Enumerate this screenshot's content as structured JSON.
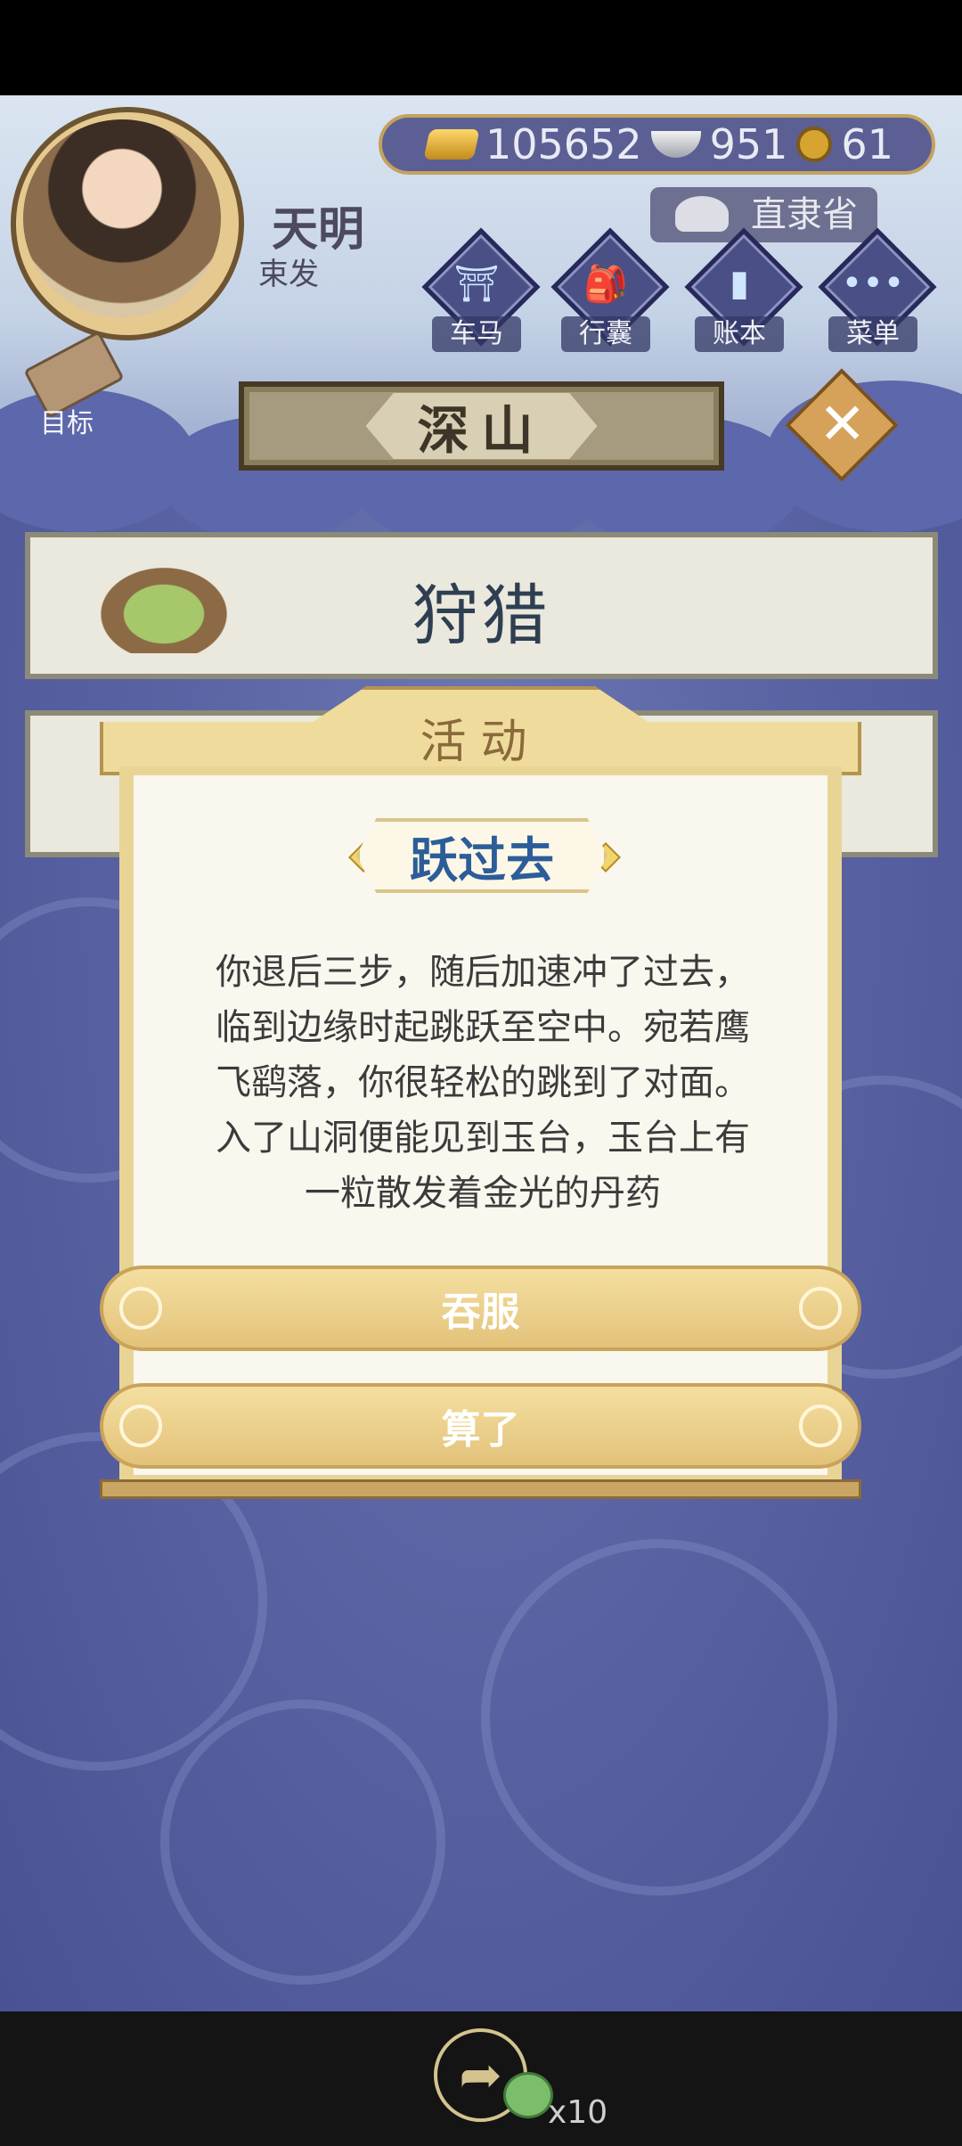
{
  "player": {
    "name": "天明",
    "rank": "束发"
  },
  "currency": {
    "gold": "105652",
    "silver": "951",
    "coins": "61"
  },
  "location": "直隶省",
  "menu": [
    {
      "label": "车马",
      "icon": "carriage-icon"
    },
    {
      "label": "行囊",
      "icon": "bag-icon"
    },
    {
      "label": "账本",
      "icon": "ledger-icon"
    },
    {
      "label": "菜单",
      "icon": "more-icon"
    }
  ],
  "target_label": "目标",
  "area_name": "深山",
  "activities": [
    "狩猎"
  ],
  "dialog": {
    "header": "活动",
    "event_title": "跃过去",
    "text": "你退后三步，随后加速冲了过去，\n临到边缘时起跳跃至空中。宛若鹰\n飞鹞落，你很轻松的跳到了对面。\n入了山洞便能见到玉台，玉台上有\n一粒散发着金光的丹药",
    "choices": [
      "吞服",
      "算了"
    ]
  },
  "share": {
    "count": "x10"
  },
  "colors": {
    "accent_gold": "#e3c27a",
    "bg_blue": "#5a63a3",
    "title_blue": "#2c5d99"
  }
}
